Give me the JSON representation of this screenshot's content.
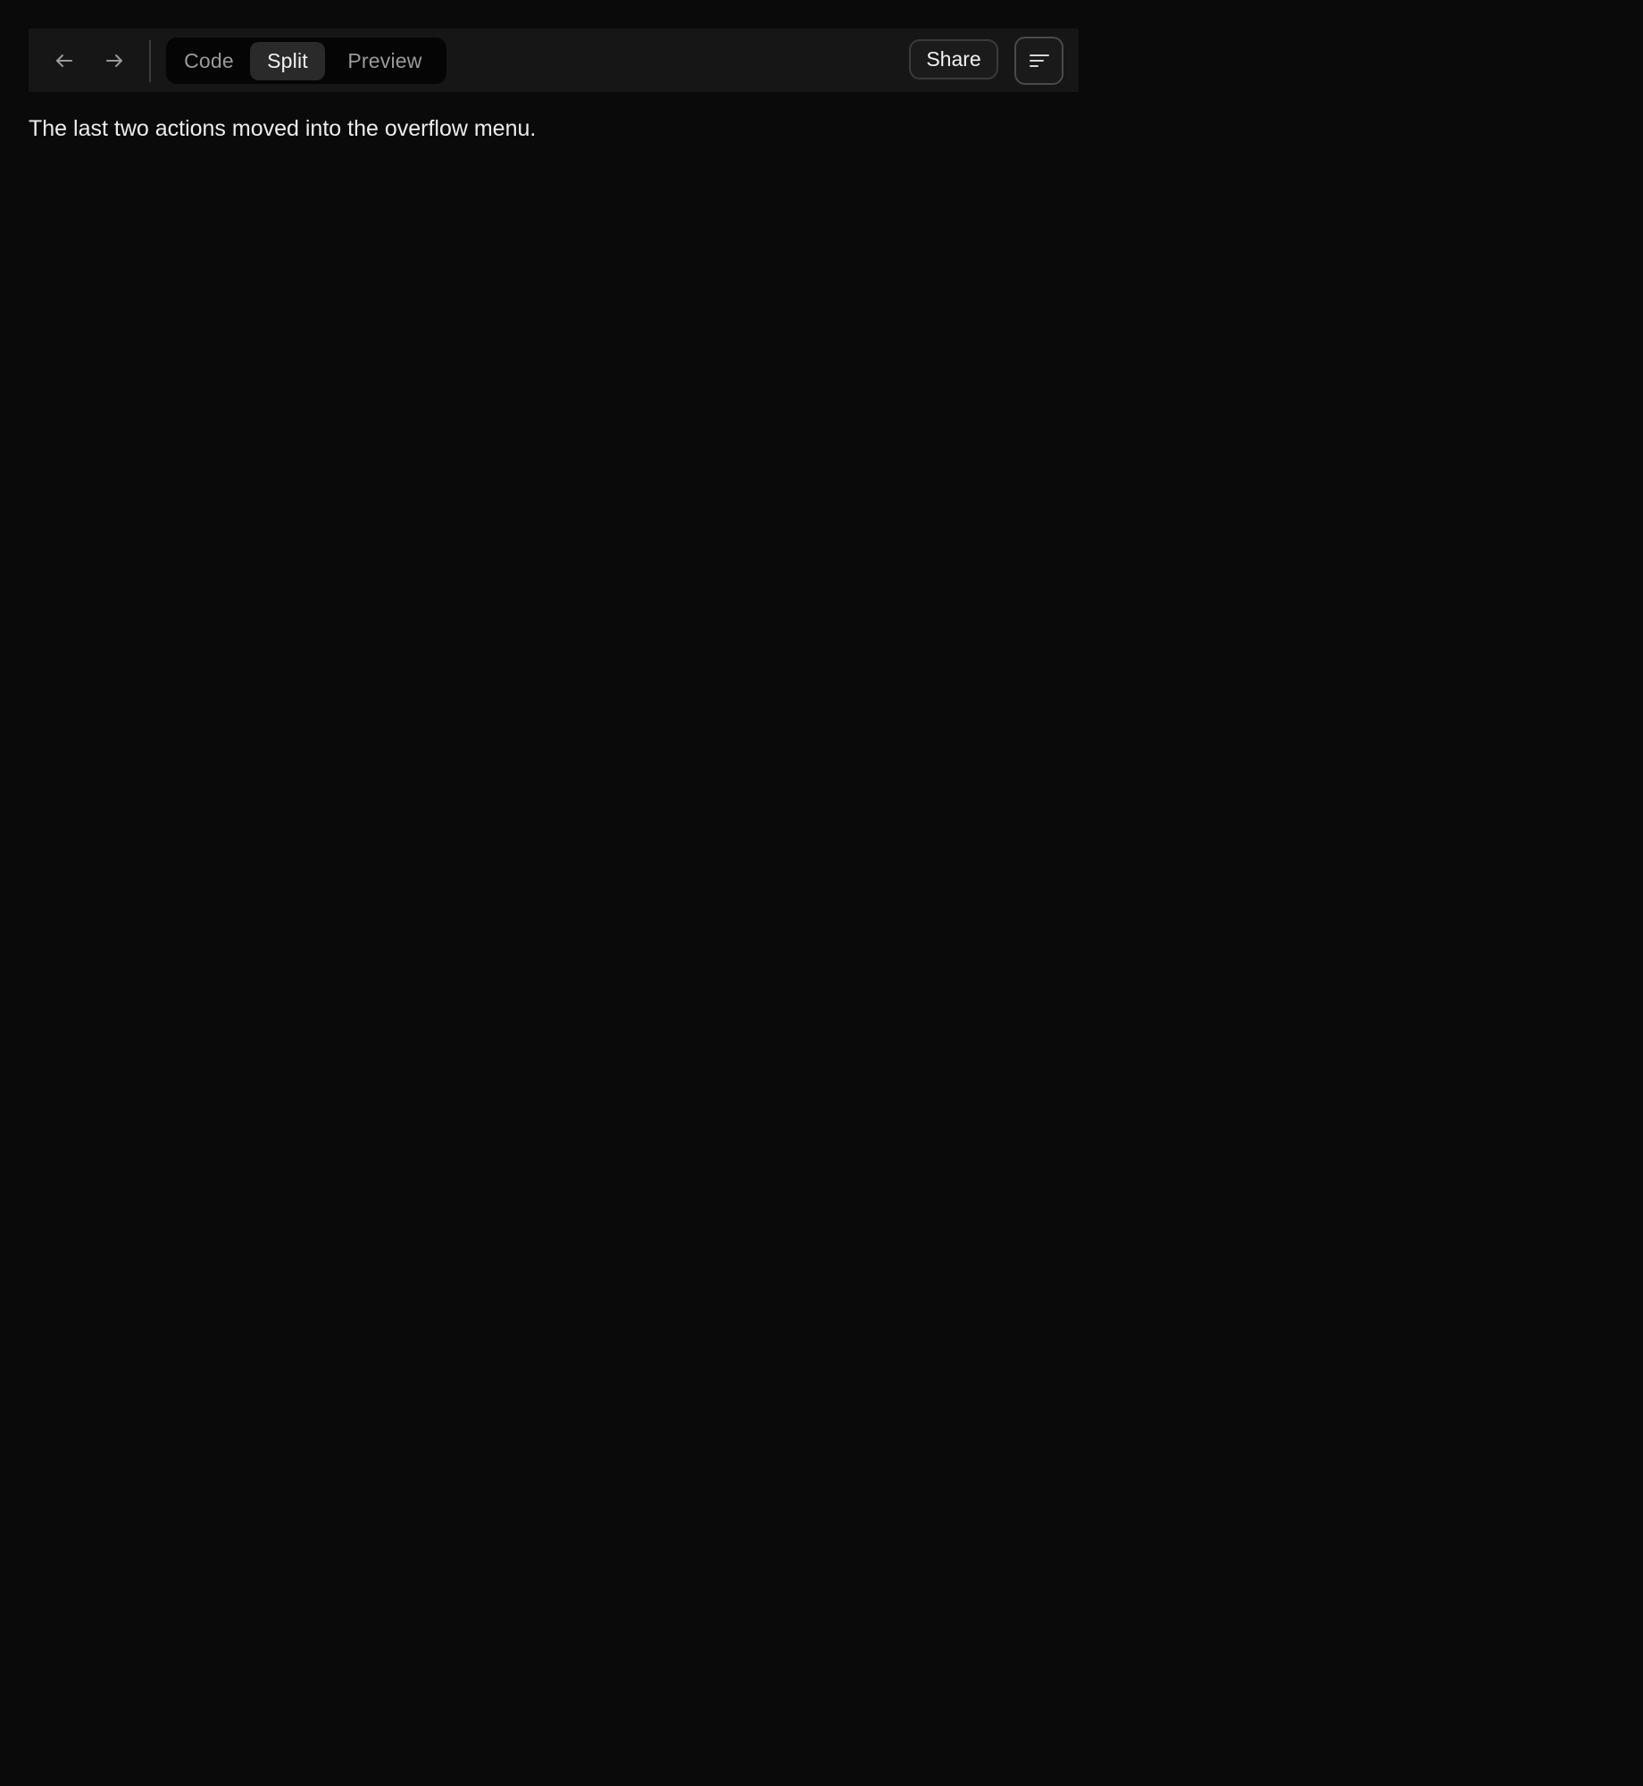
{
  "toolbar": {
    "back_icon": "arrow-left-icon",
    "forward_icon": "arrow-right-icon",
    "view_modes": [
      {
        "label": "Code",
        "selected": false
      },
      {
        "label": "Split",
        "selected": true
      },
      {
        "label": "Preview",
        "selected": false
      }
    ],
    "share_label": "Share",
    "overflow_icon": "sort-lines-icon"
  },
  "status_message": "The last two actions moved into the overflow menu.",
  "colors": {
    "background": "#0a0a0a",
    "toolbar_bg": "#161616",
    "selected_segment_bg": "#2a2a2a",
    "text": "#ededed",
    "muted_text": "#9a9a9a"
  }
}
